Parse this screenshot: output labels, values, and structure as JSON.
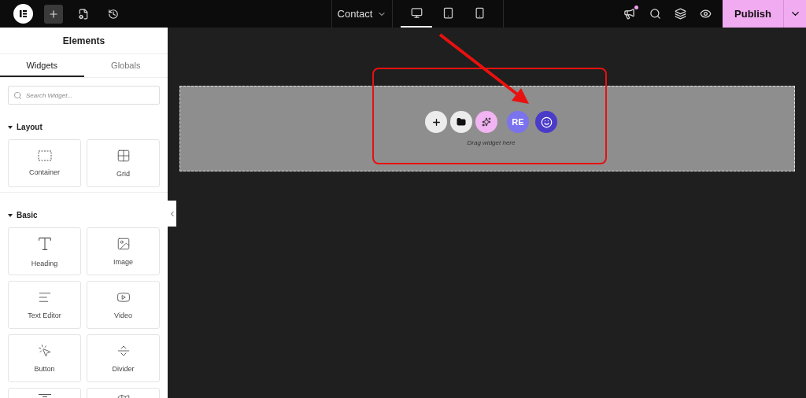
{
  "topbar": {
    "page_selector": "Contact",
    "devices": [
      {
        "kind": "desktop",
        "selected": true
      },
      {
        "kind": "tablet",
        "selected": false
      },
      {
        "kind": "mobile",
        "selected": false
      }
    ],
    "notification_dot": true,
    "publish": "Publish"
  },
  "sidebar": {
    "title": "Elements",
    "tabs": [
      {
        "label": "Widgets",
        "selected": true
      },
      {
        "label": "Globals",
        "selected": false
      }
    ],
    "search": {
      "placeholder": "Search Widget..."
    },
    "sections": [
      {
        "title": "Layout",
        "expanded": true,
        "widgets": [
          {
            "kind": "container",
            "label": "Container"
          },
          {
            "kind": "grid",
            "label": "Grid"
          }
        ]
      },
      {
        "title": "Basic",
        "expanded": true,
        "widgets": [
          {
            "kind": "heading",
            "label": "Heading"
          },
          {
            "kind": "image",
            "label": "Image"
          },
          {
            "kind": "text",
            "label": "Text Editor"
          },
          {
            "kind": "video",
            "label": "Video"
          },
          {
            "kind": "button",
            "label": "Button"
          },
          {
            "kind": "divider",
            "label": "Divider"
          },
          {
            "kind": "spacer"
          },
          {
            "kind": "map"
          }
        ]
      }
    ]
  },
  "canvas": {
    "actions": [
      {
        "kind": "add"
      },
      {
        "kind": "folder"
      },
      {
        "kind": "ai"
      },
      {
        "kind": "logo",
        "text": "RE"
      },
      {
        "kind": "face"
      }
    ],
    "hint": "Drag widget here"
  }
}
